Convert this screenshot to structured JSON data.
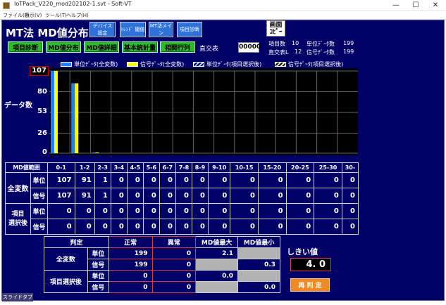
{
  "window": {
    "title": "IoTPack_V220_mod202102-1.svt - Soft-VT",
    "menu": [
      "ファイル(F)",
      "表示(V)",
      "ツール(T)",
      "ヘルプ(H)"
    ],
    "controls": {
      "minimize": "—",
      "maximize": "☐",
      "close": "✕"
    }
  },
  "header": {
    "title": "MT法  MD値分布",
    "nav_buttons": [
      {
        "line1": "デバイス",
        "line2": "設定"
      },
      {
        "line1": "ﾄﾚﾝﾄﾞ 閾値",
        "line2": ""
      },
      {
        "line1": "MT法メイン",
        "line2": ""
      },
      {
        "line1": "項目診断",
        "line2": ""
      }
    ],
    "screen_copy": {
      "line1": "画面",
      "line2": "ｺﾋﾟｰ"
    },
    "stats": {
      "item_count_label": "項目数",
      "item_count": "10",
      "unit_data_label": "単位ﾃﾞｰﾀ数",
      "unit_data": "199",
      "ortho_label": "直交表L",
      "ortho": "12",
      "signal_data_label": "信号ﾃﾞｰﾀ数",
      "signal_data": "199"
    }
  },
  "toolbar": {
    "buttons": [
      "項目診断",
      "MD値分布",
      "MD値詳細",
      "基本統計量",
      "相関行列"
    ],
    "ortho_label": "直交表",
    "ortho_value": "00000"
  },
  "chart_data": {
    "type": "bar",
    "ylabel": "データ数",
    "ylim": [
      0,
      107
    ],
    "yticks": [
      0,
      26,
      53,
      80,
      107
    ],
    "categories": [
      "0-1",
      "1-2",
      "2-3",
      "3-4",
      "4-5",
      "5-6",
      "6-7",
      "7-8",
      "8-9",
      "9-10",
      "10-15",
      "15-20",
      "20-25",
      "25-30",
      "30-"
    ],
    "series": [
      {
        "name": "単位ﾃﾞｰﾀ(全変数)",
        "color": "#1f7fff",
        "values": [
          107,
          91,
          1,
          0,
          0,
          0,
          0,
          0,
          0,
          0,
          0,
          0,
          0,
          0,
          0
        ]
      },
      {
        "name": "信号ﾃﾞｰﾀ(全変数)",
        "color": "#ffff00",
        "values": [
          107,
          91,
          1,
          0,
          0,
          0,
          0,
          0,
          0,
          0,
          0,
          0,
          0,
          0,
          0
        ]
      },
      {
        "name": "単位ﾃﾞｰﾀ(項目選択後)",
        "color": "#9ad0ff",
        "values": [
          0,
          0,
          0,
          0,
          0,
          0,
          0,
          0,
          0,
          0,
          0,
          0,
          0,
          0,
          0
        ]
      },
      {
        "name": "信号ﾃﾞｰﾀ(項目選択後)",
        "color": "#ffff66",
        "values": [
          0,
          0,
          0,
          0,
          0,
          0,
          0,
          0,
          0,
          0,
          0,
          0,
          0,
          0,
          0
        ]
      }
    ],
    "grid": true,
    "legend": "top"
  },
  "range_table": {
    "header_label": "MD値範囲",
    "all_vars_label": "全変数",
    "selected_label_1": "項目",
    "selected_label_2": "選択後",
    "unit_label": "単位",
    "signal_label": "信号"
  },
  "judge_table": {
    "headers": [
      "判定",
      "正常",
      "異常",
      "MD値最大",
      "MD値最小"
    ],
    "all_vars_label": "全変数",
    "selected_label": "項目選択後",
    "unit_label": "単位",
    "signal_label": "信号",
    "all_unit": {
      "normal": "199",
      "abnormal": "0",
      "md_max": "2.1",
      "md_min": ""
    },
    "all_signal": {
      "normal": "199",
      "abnormal": "0",
      "md_max": "",
      "md_min": "0.3"
    },
    "sel_unit": {
      "normal": "0",
      "abnormal": "0",
      "md_max": "0.0",
      "md_min": ""
    },
    "sel_signal": {
      "normal": "0",
      "abnormal": "0",
      "md_max": "",
      "md_min": "0.0"
    }
  },
  "threshold": {
    "label": "しきい値",
    "value": "4. 0"
  },
  "rejudge_label": "再 判 定",
  "slide_tab_label": "スライドタブ"
}
